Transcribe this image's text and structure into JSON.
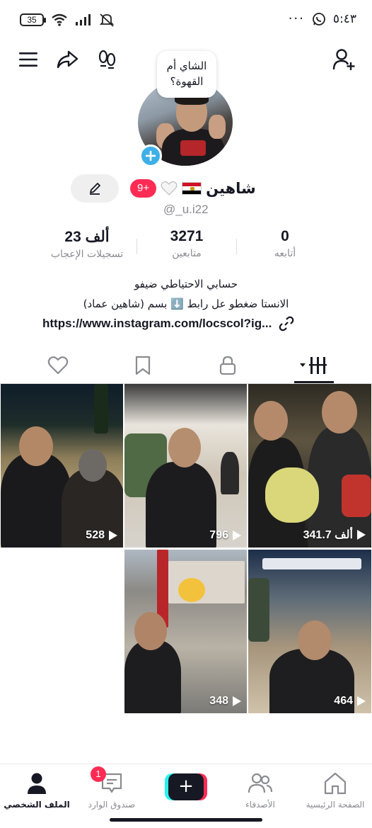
{
  "status_bar": {
    "battery": "35",
    "time": "٥:٤٣",
    "more_dots": "···"
  },
  "profile": {
    "speech_bubble_line1": "الشاي أم",
    "speech_bubble_line2": "القهوة؟",
    "display_name": "شاهين",
    "badge_count": "9+",
    "username": "@_u.i22"
  },
  "stats": {
    "likes_value": "23 ألف",
    "likes_label": "تسجيلات الإعجاب",
    "followers_value": "3271",
    "followers_label": "متابعين",
    "following_value": "0",
    "following_label": "أتابعه"
  },
  "bio": {
    "line1": "حسابي الاحتياطي ضيفو",
    "line2": "الانستا ضغطو عل رابط ⬇️ بسم (شاهين عماد)",
    "link": "https://www.instagram.com/locscol?ig..."
  },
  "tabs": [
    "videos",
    "private",
    "saved",
    "liked"
  ],
  "videos": [
    {
      "views": "528"
    },
    {
      "views": "796"
    },
    {
      "views": "341.7 ألف"
    },
    {
      "views": "348"
    },
    {
      "views": "464"
    }
  ],
  "bottom_nav": {
    "home": "الصفحة الرئيسية",
    "friends": "الأصدقاء",
    "create": "+",
    "inbox": "صندوق الوارد",
    "inbox_badge": "1",
    "profile": "الملف الشخصي"
  },
  "colors": {
    "accent": "#fe2c55",
    "badge_blue": "#3eb0e7",
    "text_primary": "#161823",
    "text_secondary": "#8a8b91"
  }
}
